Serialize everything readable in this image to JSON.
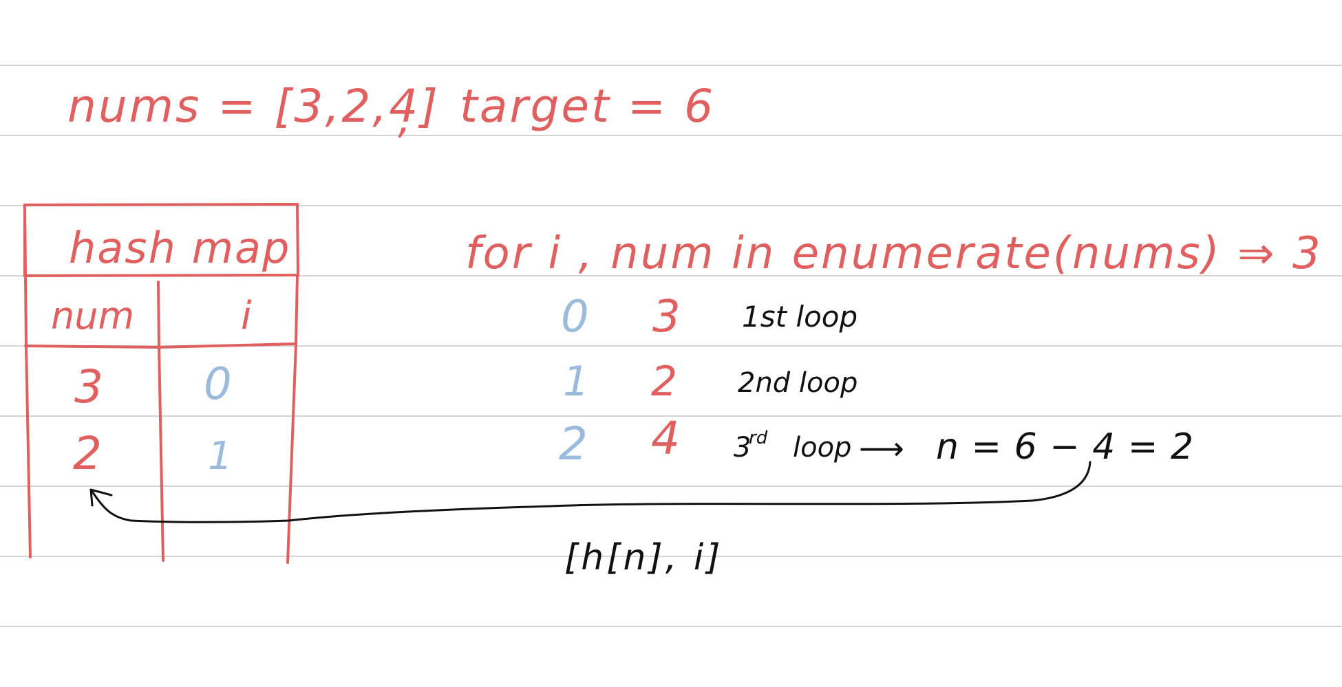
{
  "header": {
    "nums_text": "nums = [3,2,4]",
    "separator": ",",
    "target_text": "target = 6"
  },
  "hash_map": {
    "title": "hash map",
    "columns": [
      "num",
      "i"
    ],
    "rows": [
      {
        "num": "3",
        "i": "0"
      },
      {
        "num": "2",
        "i": "1"
      }
    ]
  },
  "loop": {
    "statement": "for i , num in enumerate(nums) ⇒ 3",
    "iterations": [
      {
        "i": "0",
        "num": "3",
        "label": "1st loop"
      },
      {
        "i": "1",
        "num": "2",
        "label": "2nd loop"
      },
      {
        "i": "2",
        "num": "4",
        "label_prefix": "3",
        "label_sup": "rd",
        "label_suffix": "loop"
      }
    ],
    "computation_arrow": "⟶",
    "computation": "n = 6 − 4 = 2",
    "result": "[h[n], i]"
  },
  "colors": {
    "red": "#e06060",
    "blue": "#9bbbdc",
    "ink": "#111111",
    "rule": "#d4d4d4"
  }
}
